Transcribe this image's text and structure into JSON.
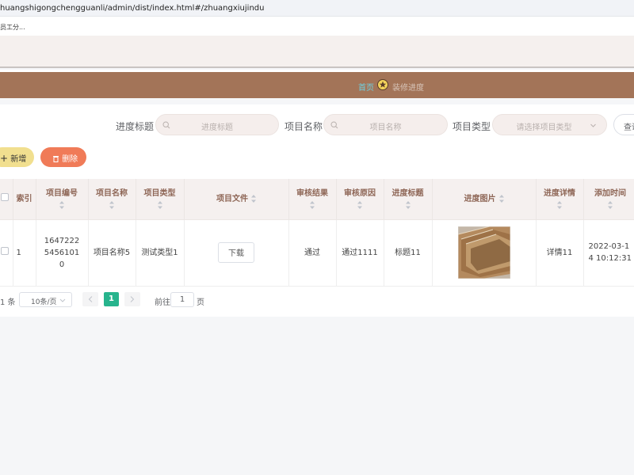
{
  "browser": {
    "url": "huangshigongchengguanli/admin/dist/index.html#/zhuangxiujindu",
    "bookmark": "员工分..."
  },
  "nav": {
    "home": "首页",
    "current": "装修进度"
  },
  "filters": {
    "progress_title_label": "进度标题",
    "progress_title_placeholder": "进度标题",
    "project_name_label": "项目名称",
    "project_name_placeholder": "项目名称",
    "project_type_label": "项目类型",
    "project_type_placeholder": "请选择项目类型",
    "search_label": "查询"
  },
  "actions": {
    "add_label": "新增",
    "delete_label": "删除"
  },
  "table": {
    "columns": [
      "索引",
      "项目编号",
      "项目名称",
      "项目类型",
      "项目文件",
      "审核结果",
      "审核原因",
      "进度标题",
      "进度图片",
      "进度详情",
      "添加时间"
    ],
    "rows": [
      {
        "index": "1",
        "project_no": "164722254561010",
        "project_name": "项目名称5",
        "project_type": "测试类型1",
        "file_button": "下载",
        "review_result": "通过",
        "review_reason": "通过1111",
        "progress_title": "标题11",
        "progress_detail": "详情11",
        "added_time": "2022-03-14 10:12:31"
      }
    ]
  },
  "pagination": {
    "total": "1 条",
    "page_size": "10条/页",
    "current_page": "1",
    "goto_label": "前往",
    "goto_value": "1",
    "page_unit": "页"
  },
  "colors": {
    "nav_bar": "#a37458",
    "header_text": "#8e6656",
    "add_button": "#f1df8f",
    "delete_button": "#f07b58",
    "active_page": "#27b48d"
  }
}
